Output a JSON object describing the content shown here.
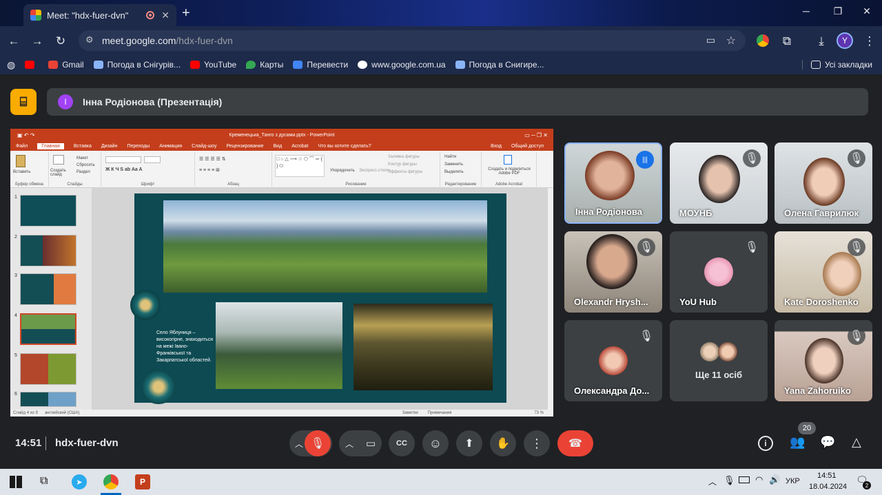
{
  "browser": {
    "tab_title": "Meet: \"hdx-fuer-dvn\"",
    "new_tab": "+",
    "url_host": "meet.google.com",
    "url_path": "/hdx-fuer-dvn",
    "profile_letter": "Y",
    "bookmarks": [
      {
        "label": "Gmail",
        "color": "#ea4335"
      },
      {
        "label": "Погода в Снігурів...",
        "color": "#8ab4f8"
      },
      {
        "label": "YouTube",
        "color": "#ff0000"
      },
      {
        "label": "Карты",
        "color": "#34a853"
      },
      {
        "label": "Перевести",
        "color": "#4285f4"
      },
      {
        "label": "www.google.com.ua",
        "color": "#ffffff"
      },
      {
        "label": "Погода в Снигире...",
        "color": "#8ab4f8"
      }
    ],
    "all_bookmarks": "Усі закладки"
  },
  "meet": {
    "presenter_initial": "І",
    "presenter_label": "Інна Родіонова (Презентація)",
    "time": "14:51",
    "meeting_code": "hdx-fuer-dvn",
    "people_count": "20",
    "participants": [
      {
        "name": "Інна Родіонова",
        "speaking": true
      },
      {
        "name": "МОУНБ"
      },
      {
        "name": "Олена Гаврилюк"
      },
      {
        "name": "Olexandr Hrysh..."
      },
      {
        "name": "YoU Hub"
      },
      {
        "name": "Kate Doroshenko"
      },
      {
        "name": "Олександра До..."
      },
      {
        "name": "Ще 11 осіб"
      },
      {
        "name": "Yana Zahoruiko"
      }
    ]
  },
  "ppt": {
    "title": "Кременецька_Танго з дусами.pptx - PowerPoint",
    "tabs": [
      "Файл",
      "Главная",
      "Вставка",
      "Дизайн",
      "Переходы",
      "Анимация",
      "Слайд-шоу",
      "Рецензирование",
      "Вид",
      "Acrobat",
      "Что вы хотите сделать?"
    ],
    "signin": "Вход",
    "share": "Общий доступ",
    "groups": [
      "Буфер обмена",
      "Слайды",
      "Шрифт",
      "Абзац",
      "Рисование",
      "Редактирование",
      "Adobe Acrobat"
    ],
    "buttons": {
      "paste": "Вставить",
      "create_slide": "Создать слайд",
      "layout": "Макет",
      "reset": "Сбросить",
      "section": "Раздел",
      "arrange": "Упорядочить",
      "express": "Экспресс-стили",
      "fill": "Заливка фигуры",
      "outline": "Контур фигуры",
      "effects": "Эффекты фигуры",
      "find": "Найти",
      "replace": "Заменить",
      "select": "Выделить",
      "adobe": "Создать и поделиться Adobe PDF"
    },
    "thumb_numbers": [
      "1",
      "2",
      "3",
      "4",
      "5",
      "6"
    ],
    "slide_caption": "Село Яблуниця – високогірне, знаходиться на межі Івано-Франківської та Закарпатської областей.",
    "status_slide": "Слайд 4 из 9",
    "status_lang": "английский (США)",
    "status_notes": "Заметки",
    "status_comments": "Примечания",
    "status_zoom": "73 %"
  },
  "taskbar": {
    "lang": "УКР",
    "time": "14:51",
    "date": "18.04.2024",
    "notif_count": "2"
  }
}
